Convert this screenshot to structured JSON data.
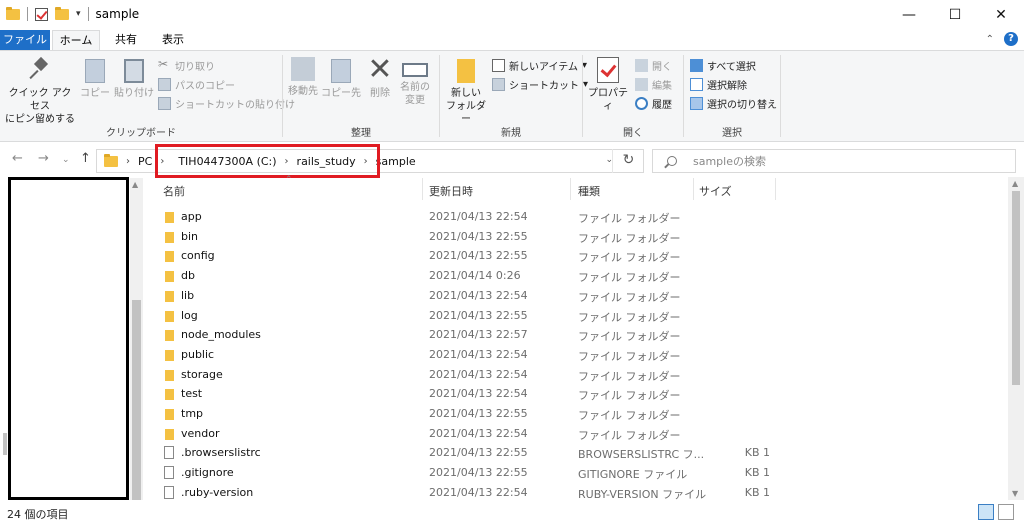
{
  "window": {
    "title": "sample",
    "controls": {
      "minimize": "—",
      "maximize": "☐",
      "close": "✕"
    }
  },
  "quick_access": {
    "dropdown": "▾"
  },
  "tabs": [
    {
      "label": "ファイル"
    },
    {
      "label": "ホーム"
    },
    {
      "label": "共有"
    },
    {
      "label": "表示"
    }
  ],
  "ribbon": {
    "clipboard": {
      "label": "クリップボード",
      "pin_line1": "クイック アクセス",
      "pin_line2": "にピン留めする",
      "copy": "コピー",
      "paste": "貼り付け",
      "cut": "切り取り",
      "copy_path": "パスのコピー",
      "paste_shortcut": "ショートカットの貼り付け"
    },
    "organize": {
      "label": "整理",
      "move_to": "移動先",
      "copy_to": "コピー先",
      "delete": "削除",
      "rename_line1": "名前の",
      "rename_line2": "変更"
    },
    "new": {
      "label": "新規",
      "new_folder_line1": "新しい",
      "new_folder_line2": "フォルダー",
      "new_item": "新しいアイテム",
      "shortcut": "ショートカット"
    },
    "open": {
      "label": "開く",
      "properties": "プロパティ",
      "open": "開く",
      "edit": "編集",
      "history": "履歴"
    },
    "select": {
      "label": "選択",
      "select_all": "すべて選択",
      "select_none": "選択解除",
      "invert": "選択の切り替え"
    }
  },
  "address": {
    "root": "PC",
    "crumbs": [
      "TIH0447300A (C:)",
      "rails_study",
      "sample"
    ],
    "search_placeholder": "sampleの検索"
  },
  "columns": {
    "name": "名前",
    "date": "更新日時",
    "type": "種類",
    "size": "サイズ"
  },
  "files": [
    {
      "name": "app",
      "date": "2021/04/13 22:54",
      "type": "ファイル フォルダー",
      "size": "",
      "kind": "folder"
    },
    {
      "name": "bin",
      "date": "2021/04/13 22:55",
      "type": "ファイル フォルダー",
      "size": "",
      "kind": "folder"
    },
    {
      "name": "config",
      "date": "2021/04/13 22:55",
      "type": "ファイル フォルダー",
      "size": "",
      "kind": "folder"
    },
    {
      "name": "db",
      "date": "2021/04/14 0:26",
      "type": "ファイル フォルダー",
      "size": "",
      "kind": "folder"
    },
    {
      "name": "lib",
      "date": "2021/04/13 22:54",
      "type": "ファイル フォルダー",
      "size": "",
      "kind": "folder"
    },
    {
      "name": "log",
      "date": "2021/04/13 22:55",
      "type": "ファイル フォルダー",
      "size": "",
      "kind": "folder"
    },
    {
      "name": "node_modules",
      "date": "2021/04/13 22:57",
      "type": "ファイル フォルダー",
      "size": "",
      "kind": "folder"
    },
    {
      "name": "public",
      "date": "2021/04/13 22:54",
      "type": "ファイル フォルダー",
      "size": "",
      "kind": "folder"
    },
    {
      "name": "storage",
      "date": "2021/04/13 22:54",
      "type": "ファイル フォルダー",
      "size": "",
      "kind": "folder"
    },
    {
      "name": "test",
      "date": "2021/04/13 22:54",
      "type": "ファイル フォルダー",
      "size": "",
      "kind": "folder"
    },
    {
      "name": "tmp",
      "date": "2021/04/13 22:55",
      "type": "ファイル フォルダー",
      "size": "",
      "kind": "folder"
    },
    {
      "name": "vendor",
      "date": "2021/04/13 22:54",
      "type": "ファイル フォルダー",
      "size": "",
      "kind": "folder"
    },
    {
      "name": ".browserslistrc",
      "date": "2021/04/13 22:55",
      "type": "BROWSERSLISTRC フ...",
      "size": "1 KB",
      "kind": "file"
    },
    {
      "name": ".gitignore",
      "date": "2021/04/13 22:55",
      "type": "GITIGNORE ファイル",
      "size": "1 KB",
      "kind": "file"
    },
    {
      "name": ".ruby-version",
      "date": "2021/04/13 22:54",
      "type": "RUBY-VERSION ファイル",
      "size": "1 KB",
      "kind": "file"
    }
  ],
  "status": {
    "item_count": "24 個の項目"
  }
}
